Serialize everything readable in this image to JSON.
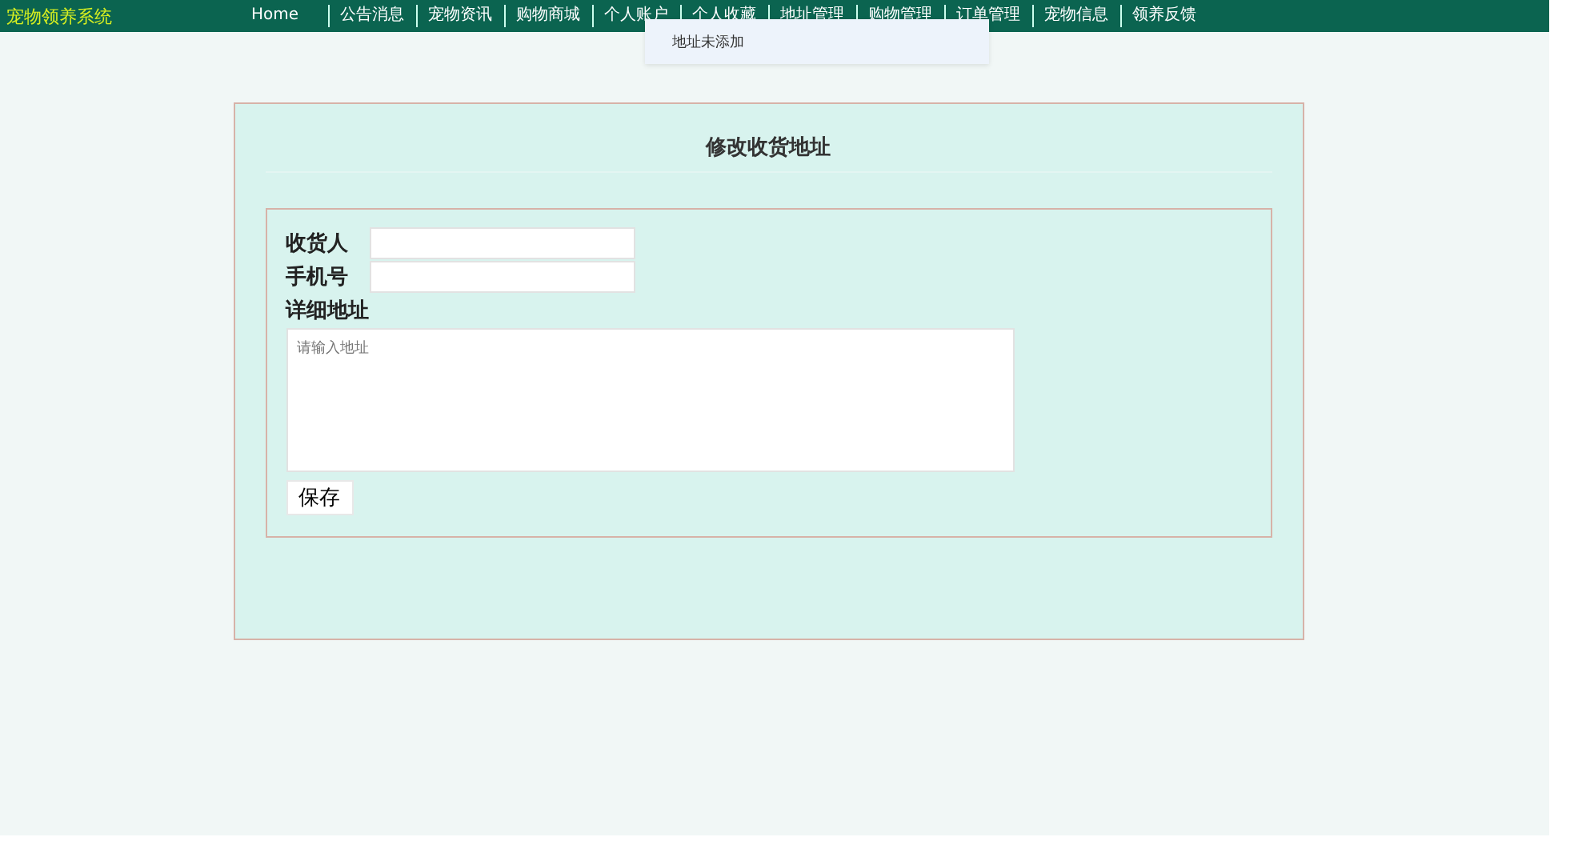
{
  "brand": "宠物领养系统",
  "nav": [
    {
      "label": "Home"
    },
    {
      "label": "公告消息"
    },
    {
      "label": "宠物资讯"
    },
    {
      "label": "购物商城"
    },
    {
      "label": "个人账户"
    },
    {
      "label": "个人收藏"
    },
    {
      "label": "地址管理"
    },
    {
      "label": "购物管理"
    },
    {
      "label": "订单管理"
    },
    {
      "label": "宠物信息"
    },
    {
      "label": "领养反馈"
    }
  ],
  "dropdown": {
    "items": [
      "地址未添加"
    ]
  },
  "form": {
    "title": "修改收货地址",
    "fields": [
      {
        "label": "收货人",
        "kind": "input"
      },
      {
        "label": "手机号",
        "kind": "input"
      },
      {
        "label": "详细地址",
        "kind": "textarea",
        "placeholder": "请输入地址"
      }
    ],
    "button": "保存"
  }
}
